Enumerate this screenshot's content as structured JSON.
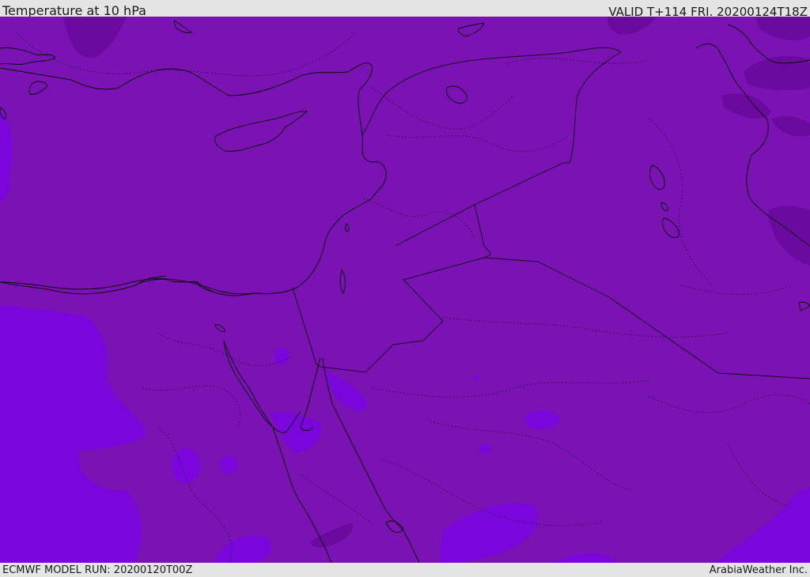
{
  "header": {
    "title": "Temperature at 10 hPa",
    "valid": "VALID T+114 FRI. 20200124T18Z"
  },
  "footer": {
    "model_run": "ECMWF MODEL RUN: 20200120T00Z",
    "credit": "ArabiaWeather Inc."
  },
  "map": {
    "colors": {
      "field_base": "#7a12b4",
      "field_warm": "#7b06dc",
      "field_cold": "#6a0a9e",
      "coastline": "#111111",
      "border": "#222222"
    }
  }
}
